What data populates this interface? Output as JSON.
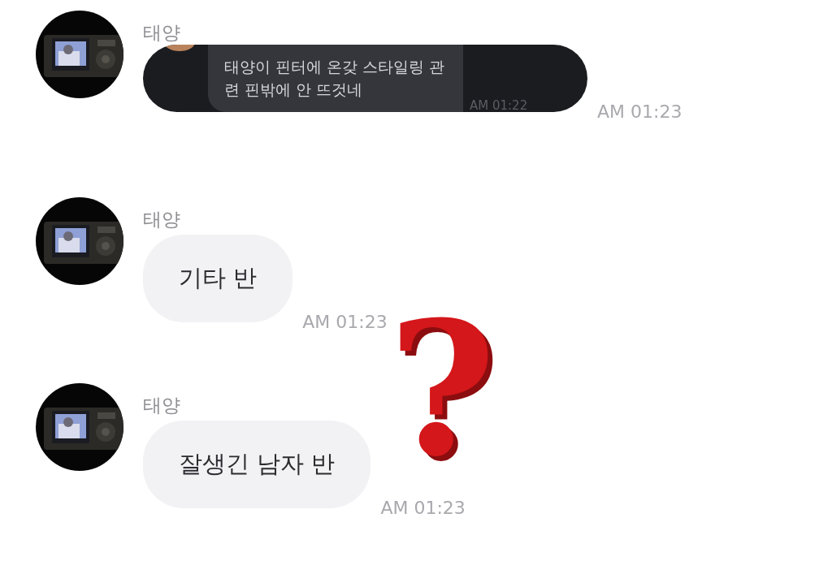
{
  "messages": [
    {
      "sender": "태양",
      "inner_text": "태양이 핀터에 온갖 스타일링 관련 핀밖에 안 뜨것네",
      "inner_time": "AM 01:22",
      "time": "AM 01:23"
    },
    {
      "sender": "태양",
      "kind": "text",
      "text": "기타 반",
      "time": "AM 01:23"
    },
    {
      "sender": "태양",
      "kind": "text",
      "text": "잘생긴 남자 반",
      "time": "AM 01:23"
    }
  ],
  "overlay_mark": "?"
}
